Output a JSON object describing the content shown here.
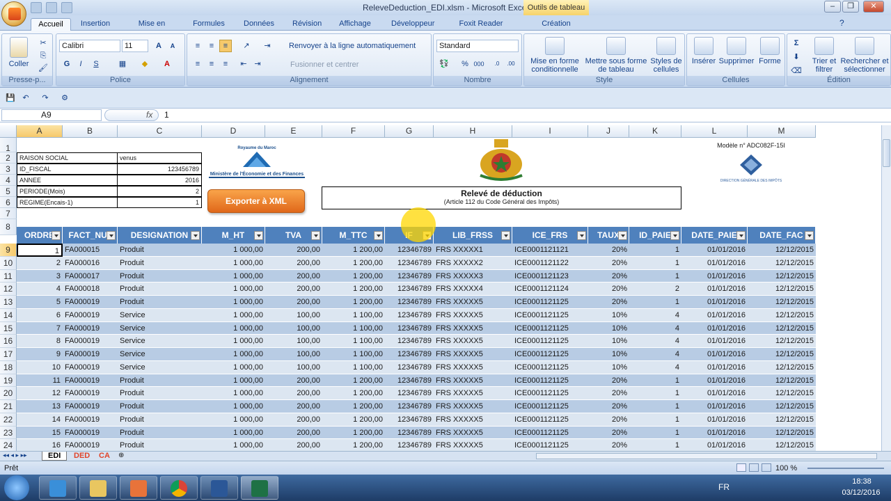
{
  "window": {
    "title": "ReleveDeduction_EDI.xlsm - Microsoft Excel",
    "context_tab": "Outils de tableau"
  },
  "tabs": [
    "Accueil",
    "Insertion",
    "Mise en page",
    "Formules",
    "Données",
    "Révision",
    "Affichage",
    "Développeur",
    "Foxit Reader PDF",
    "Création"
  ],
  "ribbon": {
    "clipboard": {
      "paste": "Coller",
      "label": "Presse-p..."
    },
    "font": {
      "name": "Calibri",
      "size": "11",
      "bold": "G",
      "italic": "I",
      "underline": "S",
      "label": "Police"
    },
    "alignment": {
      "wrap": "Renvoyer à la ligne automatiquement",
      "merge": "Fusionner et centrer",
      "label": "Alignement"
    },
    "number": {
      "format": "Standard",
      "label": "Nombre"
    },
    "style": {
      "cond": [
        "Mise en forme",
        "conditionnelle"
      ],
      "table": [
        "Mettre sous forme",
        "de tableau"
      ],
      "cell": [
        "Styles de",
        "cellules"
      ],
      "label": "Style"
    },
    "cells": {
      "insert": "Insérer",
      "delete": "Supprimer",
      "format": "Forme",
      "label": "Cellules"
    },
    "editing": {
      "sort": [
        "Trier et",
        "filtrer"
      ],
      "find": [
        "Rechercher et",
        "sélectionner"
      ],
      "label": "Édition"
    }
  },
  "formula_bar": {
    "name_box": "A9",
    "fx": "fx",
    "content": "1"
  },
  "columns": [
    "A",
    "B",
    "C",
    "D",
    "E",
    "F",
    "G",
    "H",
    "I",
    "J",
    "K",
    "L",
    "M"
  ],
  "row_numbers": [
    "1",
    "2",
    "3",
    "4",
    "5",
    "6",
    "7",
    "8",
    "9",
    "10",
    "11",
    "12",
    "13",
    "14",
    "15",
    "16",
    "17",
    "18",
    "19",
    "20",
    "21",
    "22",
    "23",
    "24"
  ],
  "info_block": [
    {
      "label": "RAISON SOCIAL",
      "value": "venus"
    },
    {
      "label": "ID_FISCAL",
      "value": "123456789"
    },
    {
      "label": "ANNEE",
      "value": "2016"
    },
    {
      "label": "PERIODE(Mois)",
      "value": "2"
    },
    {
      "label": "REGIME(Encais-1)",
      "value": "1"
    }
  ],
  "logo_left": {
    "top": "Royaume du Maroc",
    "bottom": "Ministère de l'Économie et des Finances"
  },
  "export_button": "Exporter à XML",
  "report": {
    "title": "Relevé de déduction",
    "subtitle": "(Article 112 du Code Général des Impôts)"
  },
  "model": {
    "ref": "Modèle n° ADC082F-15I",
    "org": "DIRECTION GÉNÉRALE DES IMPÔTS"
  },
  "table_headers": [
    "ORDRE",
    "FACT_NUM",
    "DESIGNATION",
    "M_HT",
    "TVA",
    "M_TTC",
    "IF",
    "LIB_FRSS",
    "ICE_FRS",
    "TAUX",
    "ID_PAIE",
    "DATE_PAIE",
    "DATE_FAC"
  ],
  "rows": [
    [
      "1",
      "FA000015",
      "Produit",
      "1 000,00",
      "200,00",
      "1 200,00",
      "12346789",
      "FRS XXXXX1",
      "ICE0001121121",
      "20%",
      "1",
      "01/01/2016",
      "12/12/2015"
    ],
    [
      "2",
      "FA000016",
      "Produit",
      "1 000,00",
      "200,00",
      "1 200,00",
      "12346789",
      "FRS XXXXX2",
      "ICE0001121122",
      "20%",
      "1",
      "01/01/2016",
      "12/12/2015"
    ],
    [
      "3",
      "FA000017",
      "Produit",
      "1 000,00",
      "200,00",
      "1 200,00",
      "12346789",
      "FRS XXXXX3",
      "ICE0001121123",
      "20%",
      "1",
      "01/01/2016",
      "12/12/2015"
    ],
    [
      "4",
      "FA000018",
      "Produit",
      "1 000,00",
      "200,00",
      "1 200,00",
      "12346789",
      "FRS XXXXX4",
      "ICE0001121124",
      "20%",
      "2",
      "01/01/2016",
      "12/12/2015"
    ],
    [
      "5",
      "FA000019",
      "Produit",
      "1 000,00",
      "200,00",
      "1 200,00",
      "12346789",
      "FRS XXXXX5",
      "ICE0001121125",
      "20%",
      "1",
      "01/01/2016",
      "12/12/2015"
    ],
    [
      "6",
      "FA000019",
      "Service",
      "1 000,00",
      "100,00",
      "1 100,00",
      "12346789",
      "FRS XXXXX5",
      "ICE0001121125",
      "10%",
      "4",
      "01/01/2016",
      "12/12/2015"
    ],
    [
      "7",
      "FA000019",
      "Service",
      "1 000,00",
      "100,00",
      "1 100,00",
      "12346789",
      "FRS XXXXX5",
      "ICE0001121125",
      "10%",
      "4",
      "01/01/2016",
      "12/12/2015"
    ],
    [
      "8",
      "FA000019",
      "Service",
      "1 000,00",
      "100,00",
      "1 100,00",
      "12346789",
      "FRS XXXXX5",
      "ICE0001121125",
      "10%",
      "4",
      "01/01/2016",
      "12/12/2015"
    ],
    [
      "9",
      "FA000019",
      "Service",
      "1 000,00",
      "100,00",
      "1 100,00",
      "12346789",
      "FRS XXXXX5",
      "ICE0001121125",
      "10%",
      "4",
      "01/01/2016",
      "12/12/2015"
    ],
    [
      "10",
      "FA000019",
      "Service",
      "1 000,00",
      "100,00",
      "1 100,00",
      "12346789",
      "FRS XXXXX5",
      "ICE0001121125",
      "10%",
      "4",
      "01/01/2016",
      "12/12/2015"
    ],
    [
      "11",
      "FA000019",
      "Produit",
      "1 000,00",
      "200,00",
      "1 200,00",
      "12346789",
      "FRS XXXXX5",
      "ICE0001121125",
      "20%",
      "1",
      "01/01/2016",
      "12/12/2015"
    ],
    [
      "12",
      "FA000019",
      "Produit",
      "1 000,00",
      "200,00",
      "1 200,00",
      "12346789",
      "FRS XXXXX5",
      "ICE0001121125",
      "20%",
      "1",
      "01/01/2016",
      "12/12/2015"
    ],
    [
      "13",
      "FA000019",
      "Produit",
      "1 000,00",
      "200,00",
      "1 200,00",
      "12346789",
      "FRS XXXXX5",
      "ICE0001121125",
      "20%",
      "1",
      "01/01/2016",
      "12/12/2015"
    ],
    [
      "14",
      "FA000019",
      "Produit",
      "1 000,00",
      "200,00",
      "1 200,00",
      "12346789",
      "FRS XXXXX5",
      "ICE0001121125",
      "20%",
      "1",
      "01/01/2016",
      "12/12/2015"
    ],
    [
      "15",
      "FA000019",
      "Produit",
      "1 000,00",
      "200,00",
      "1 200,00",
      "12346789",
      "FRS XXXXX5",
      "ICE0001121125",
      "20%",
      "1",
      "01/01/2016",
      "12/12/2015"
    ],
    [
      "16",
      "FA000019",
      "Produit",
      "1 000,00",
      "200,00",
      "1 200,00",
      "12346789",
      "FRS XXXXX5",
      "ICE0001121125",
      "20%",
      "1",
      "01/01/2016",
      "12/12/2015"
    ]
  ],
  "sheet_tabs": [
    "EDI",
    "DED",
    "CA"
  ],
  "status": {
    "ready": "Prêt",
    "zoom": "100 %"
  },
  "taskbar": {
    "lang": "FR",
    "time": "18:38",
    "date": "03/12/2016"
  },
  "colors": {
    "header_blue": "#4f81bd",
    "band_light": "#dce6f1",
    "band_dark": "#b8cce4",
    "accent_orange": "#f07d1a"
  }
}
